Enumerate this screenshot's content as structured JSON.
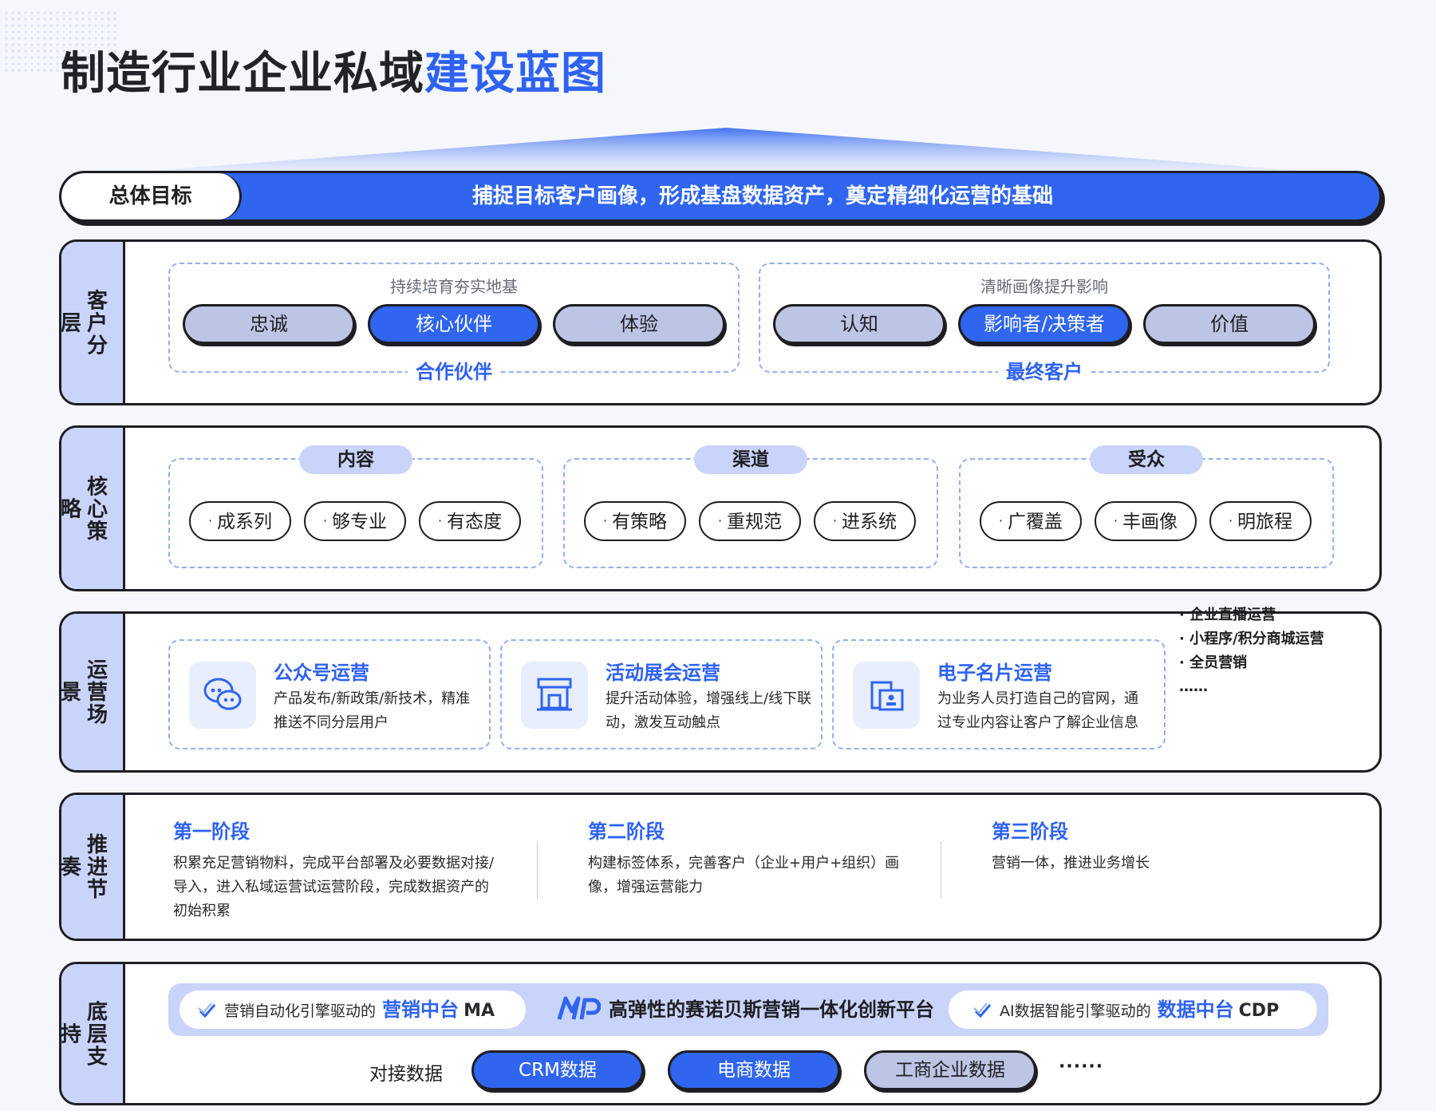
{
  "title": {
    "main": "制造行业企业私域",
    "highlight": "建设蓝图"
  },
  "goal": {
    "label": "总体目标",
    "text": "捕捉目标客户画像，形成基盘数据资产，奠定精细化运营的基础"
  },
  "customer_layers": {
    "side": "客户分层",
    "groups": [
      {
        "caption": "持续培育夯实地基",
        "footer": "合作伙伴",
        "pills": [
          "忠诚",
          "核心伙伴",
          "体验"
        ]
      },
      {
        "caption": "清晰画像提升影响",
        "footer": "最终客户",
        "pills": [
          "认知",
          "影响者/决策者",
          "价值"
        ]
      }
    ]
  },
  "core_strategy": {
    "side": "核心策略",
    "groups": [
      {
        "tag": "内容",
        "items": [
          "成系列",
          "够专业",
          "有态度"
        ]
      },
      {
        "tag": "渠道",
        "items": [
          "有策略",
          "重规范",
          "进系统"
        ]
      },
      {
        "tag": "受众",
        "items": [
          "广覆盖",
          "丰画像",
          "明旅程"
        ]
      }
    ]
  },
  "scenarios": {
    "side": "运营场景",
    "cards": [
      {
        "icon": "wechat-chat-icon",
        "title": "公众号运营",
        "desc": "产品发布/新政策/新技术，精准推送不同分层用户"
      },
      {
        "icon": "exhibition-booth-icon",
        "title": "活动展会运营",
        "desc": "提升活动体验，增强线上/线下联动，激发互动触点"
      },
      {
        "icon": "business-card-icon",
        "title": "电子名片运营",
        "desc": "为业务人员打造自己的官网，通过专业内容让客户了解企业信息"
      }
    ],
    "extra": [
      "· 企业直播运营",
      "· 小程序/积分商城运营",
      "· 全员营销",
      "……"
    ]
  },
  "rhythm": {
    "side": "推进节奏",
    "stages": [
      {
        "title": "第一阶段",
        "desc": "积累充足营销物料，完成平台部署及必要数据对接/导入，进入私域运营试运营阶段，完成数据资产的初始积累"
      },
      {
        "title": "第二阶段",
        "desc": "构建标签体系，完善客户（企业+用户+组织）画像，增强运营能力"
      },
      {
        "title": "第三阶段",
        "desc": "营销一体，推进业务增长"
      }
    ]
  },
  "foundation": {
    "side": "底层支持",
    "left": {
      "prefix": "营销自动化引擎驱动的",
      "name": "营销中台",
      "code": "MA"
    },
    "center": "高弹性的赛诺贝斯营销一体化创新平台",
    "right": {
      "prefix": "AI数据智能引擎驱动的",
      "name": "数据中台",
      "code": "CDP"
    },
    "data_label": "对接数据",
    "data_sources": [
      "CRM数据",
      "电商数据",
      "工商企业数据"
    ],
    "more": "······"
  },
  "colors": {
    "accent": "#2f65ef",
    "side": "#c9d4fa",
    "pill_grey": "#bcc5e4",
    "border": "#1e1e22"
  }
}
